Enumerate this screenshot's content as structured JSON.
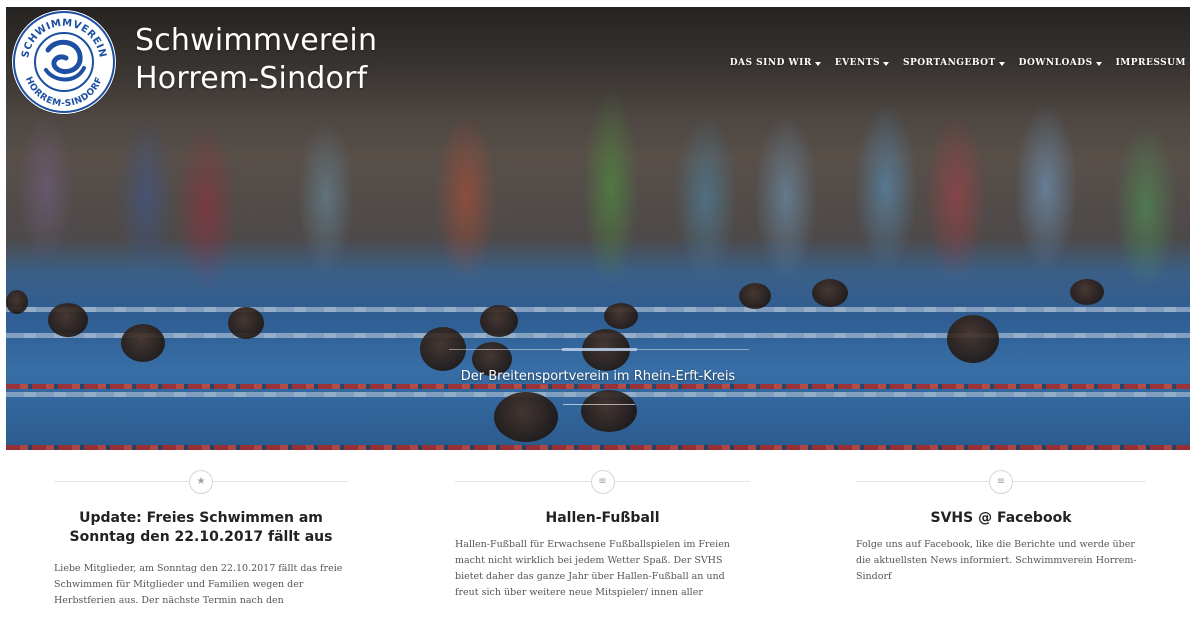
{
  "header": {
    "title_line1": "Schwimmverein",
    "title_line2": "Horrem-Sindorf",
    "logo_text_top": "SCHWIMMVEREIN",
    "logo_text_bottom": "HORREM-SINDORF"
  },
  "nav": {
    "items": [
      {
        "label": "DAS SIND WIR",
        "dropdown": true
      },
      {
        "label": "EVENTS",
        "dropdown": true
      },
      {
        "label": "SPORTANGEBOT",
        "dropdown": true
      },
      {
        "label": "DOWNLOADS",
        "dropdown": true
      },
      {
        "label": "IMPRESSUM",
        "dropdown": false
      }
    ]
  },
  "hero": {
    "tagline": "Der Breitensportverein im Rhein-Erft-Kreis"
  },
  "columns": [
    {
      "icon": "star-icon",
      "icon_glyph": "★",
      "title": "Update: Freies Schwimmen am Sonntag den 22.10.2017 fällt aus",
      "text": "Liebe Mitglieder, am Sonntag den 22.10.2017 fällt das freie Schwimmen für Mitglieder und Familien wegen der Herbstferien aus. Der nächste Termin nach den"
    },
    {
      "icon": "list-icon",
      "icon_glyph": "≡",
      "title": "Hallen-Fußball",
      "text": "Hallen-Fußball für Erwachsene Fußballspielen im Freien macht nicht wirklich bei jedem Wetter Spaß. Der SVHS bietet daher das ganze Jahr über Hallen-Fußball an und freut sich über weitere neue Mitspieler/ innen aller"
    },
    {
      "icon": "list-icon",
      "icon_glyph": "≡",
      "title": "SVHS @ Facebook",
      "text": "Folge uns auf Facebook, like die Berichte und werde über die aktuellsten News informiert. Schwimmverein Horrem-Sindorf"
    }
  ],
  "colors": {
    "logo_blue": "#1d4fa3",
    "title_text": "#222222",
    "body_text": "#555555"
  }
}
